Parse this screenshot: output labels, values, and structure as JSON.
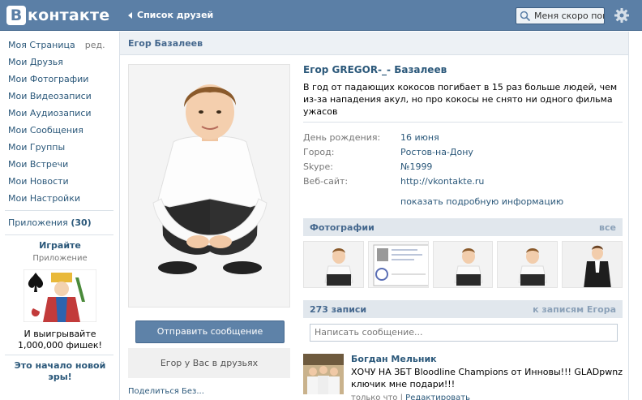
{
  "header": {
    "logo_letter": "В",
    "logo_text": "контакте",
    "back_label": "Список друзей",
    "search_text": "Меня скоро пока",
    "colors": {
      "bar": "#5b7fa6",
      "link": "#2b587a"
    }
  },
  "sidebar": {
    "my_page": "Моя Страница",
    "edit_label": "ред.",
    "items": [
      {
        "label": "Мои Друзья"
      },
      {
        "label": "Мои Фотографии"
      },
      {
        "label": "Мои Видеозаписи"
      },
      {
        "label": "Мои Аудиозаписи"
      },
      {
        "label": "Мои Сообщения"
      },
      {
        "label": "Мои Группы"
      },
      {
        "label": "Мои Встречи"
      },
      {
        "label": "Мои Новости"
      },
      {
        "label": "Мои Настройки"
      }
    ],
    "apps_label": "Приложения",
    "apps_count": "(30)",
    "ad": {
      "title": "Играйте",
      "subtitle": "Приложение",
      "text_line1": "И выигрывайте",
      "text_line2": "1,000,000 фишек!"
    },
    "ad2_line1": "Это начало новой",
    "ad2_line2": "эры!"
  },
  "page": {
    "title": "Егор Базалеев",
    "send_button": "Отправить сообщение",
    "friend_status": "Егор у Вас в друзьях",
    "bottom_cut_text": "Поделиться Без..."
  },
  "profile": {
    "name": "Егор GREGOR-_- Базалеев",
    "status": "В год от падающих кокосов погибает в 15 раз больше людей, чем из-за нападения акул, но про кокосы не снято ни одного фильма ужасов",
    "info": [
      {
        "label": "День рождения:",
        "value": "16 июня"
      },
      {
        "label": "Город:",
        "value": "Ростов-на-Дону"
      },
      {
        "label": "Skype:",
        "value": "№1999"
      },
      {
        "label": "Веб-сайт:",
        "value": "http://vkontakte.ru"
      }
    ],
    "more_link": "показать подробную информацию"
  },
  "photos": {
    "title": "Фотографии",
    "all_link": "все"
  },
  "wall": {
    "count_label": "273 записи",
    "to_wall_link": "к записям Егора",
    "input_placeholder": "Написать сообщение...",
    "post": {
      "author": "Богдан Мельник",
      "text_line1": "ХОЧУ НА ЗБТ Bloodline Champions от Инновы!!! GLADpwnz",
      "text_line2": "ключик мне подари!!!",
      "time": "только что",
      "separator": "|",
      "action": "Редактировать"
    }
  }
}
